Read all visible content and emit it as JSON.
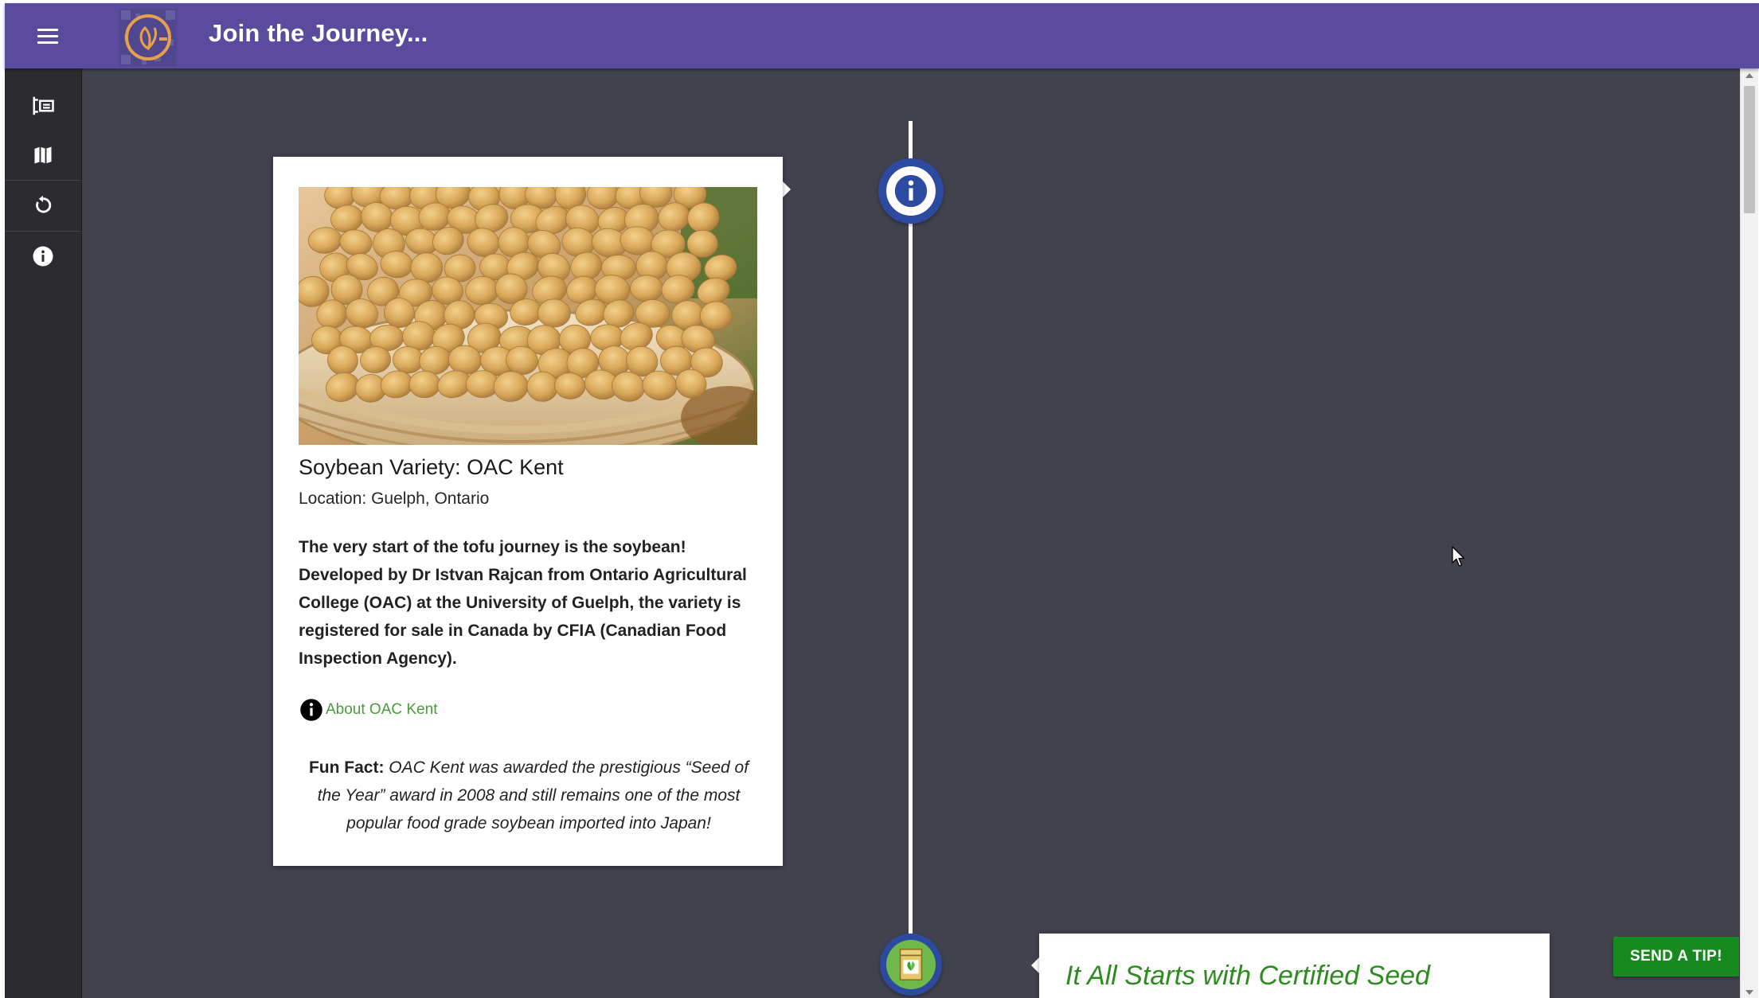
{
  "header": {
    "title": "Join the Journey..."
  },
  "colors": {
    "appbar": "#5a4b9f",
    "sidebar": "#2c2c30",
    "background": "#42424f",
    "link": "#4a9a3e",
    "accent_green": "#178a1f",
    "timeline_node": "#2c4aa0"
  },
  "sidebar": {
    "items": [
      {
        "icon": "timeline-list-icon"
      },
      {
        "icon": "map-icon"
      },
      {
        "icon": "restart-icon"
      },
      {
        "icon": "info-icon"
      }
    ]
  },
  "timeline": {
    "card1": {
      "title": "Soybean Variety: OAC Kent",
      "location": "Location: Guelph, Ontario",
      "description": "The very start of the tofu journey is the soybean! Developed by Dr Istvan Rajcan from Ontario Agricultural College (OAC) at the University of Guelph, the variety is registered for sale in Canada by CFIA (Canadian Food Inspection Agency).",
      "link_label": "About OAC Kent",
      "fun_fact_label": "Fun Fact:",
      "fun_fact_text": "OAC Kent was awarded the prestigious “Seed of the Year” award in 2008 and still remains one of the most popular food grade soybean imported into Japan!"
    },
    "card2": {
      "title": "It All Starts with Certified Seed"
    }
  },
  "tip_button": {
    "label": "SEND A TIP!"
  }
}
